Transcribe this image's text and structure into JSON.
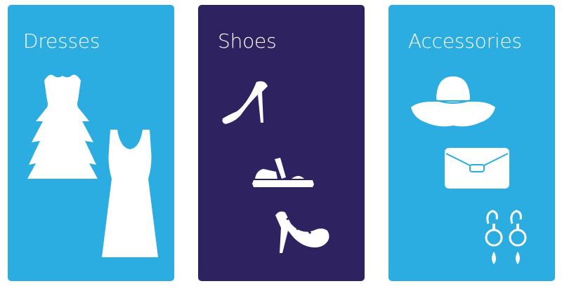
{
  "colors": {
    "light_card": "#2cade1",
    "dark_card": "#2e2260",
    "icon": "#ffffff"
  },
  "categories": [
    {
      "title": "Dresses",
      "icons": [
        "strapless-tiered-dress-icon",
        "tank-dress-icon"
      ]
    },
    {
      "title": "Shoes",
      "icons": [
        "stiletto-pump-icon",
        "flat-sandal-icon",
        "strappy-heel-icon"
      ]
    },
    {
      "title": "Accessories",
      "icons": [
        "sun-hat-icon",
        "clutch-bag-icon",
        "drop-earrings-icon"
      ]
    }
  ]
}
